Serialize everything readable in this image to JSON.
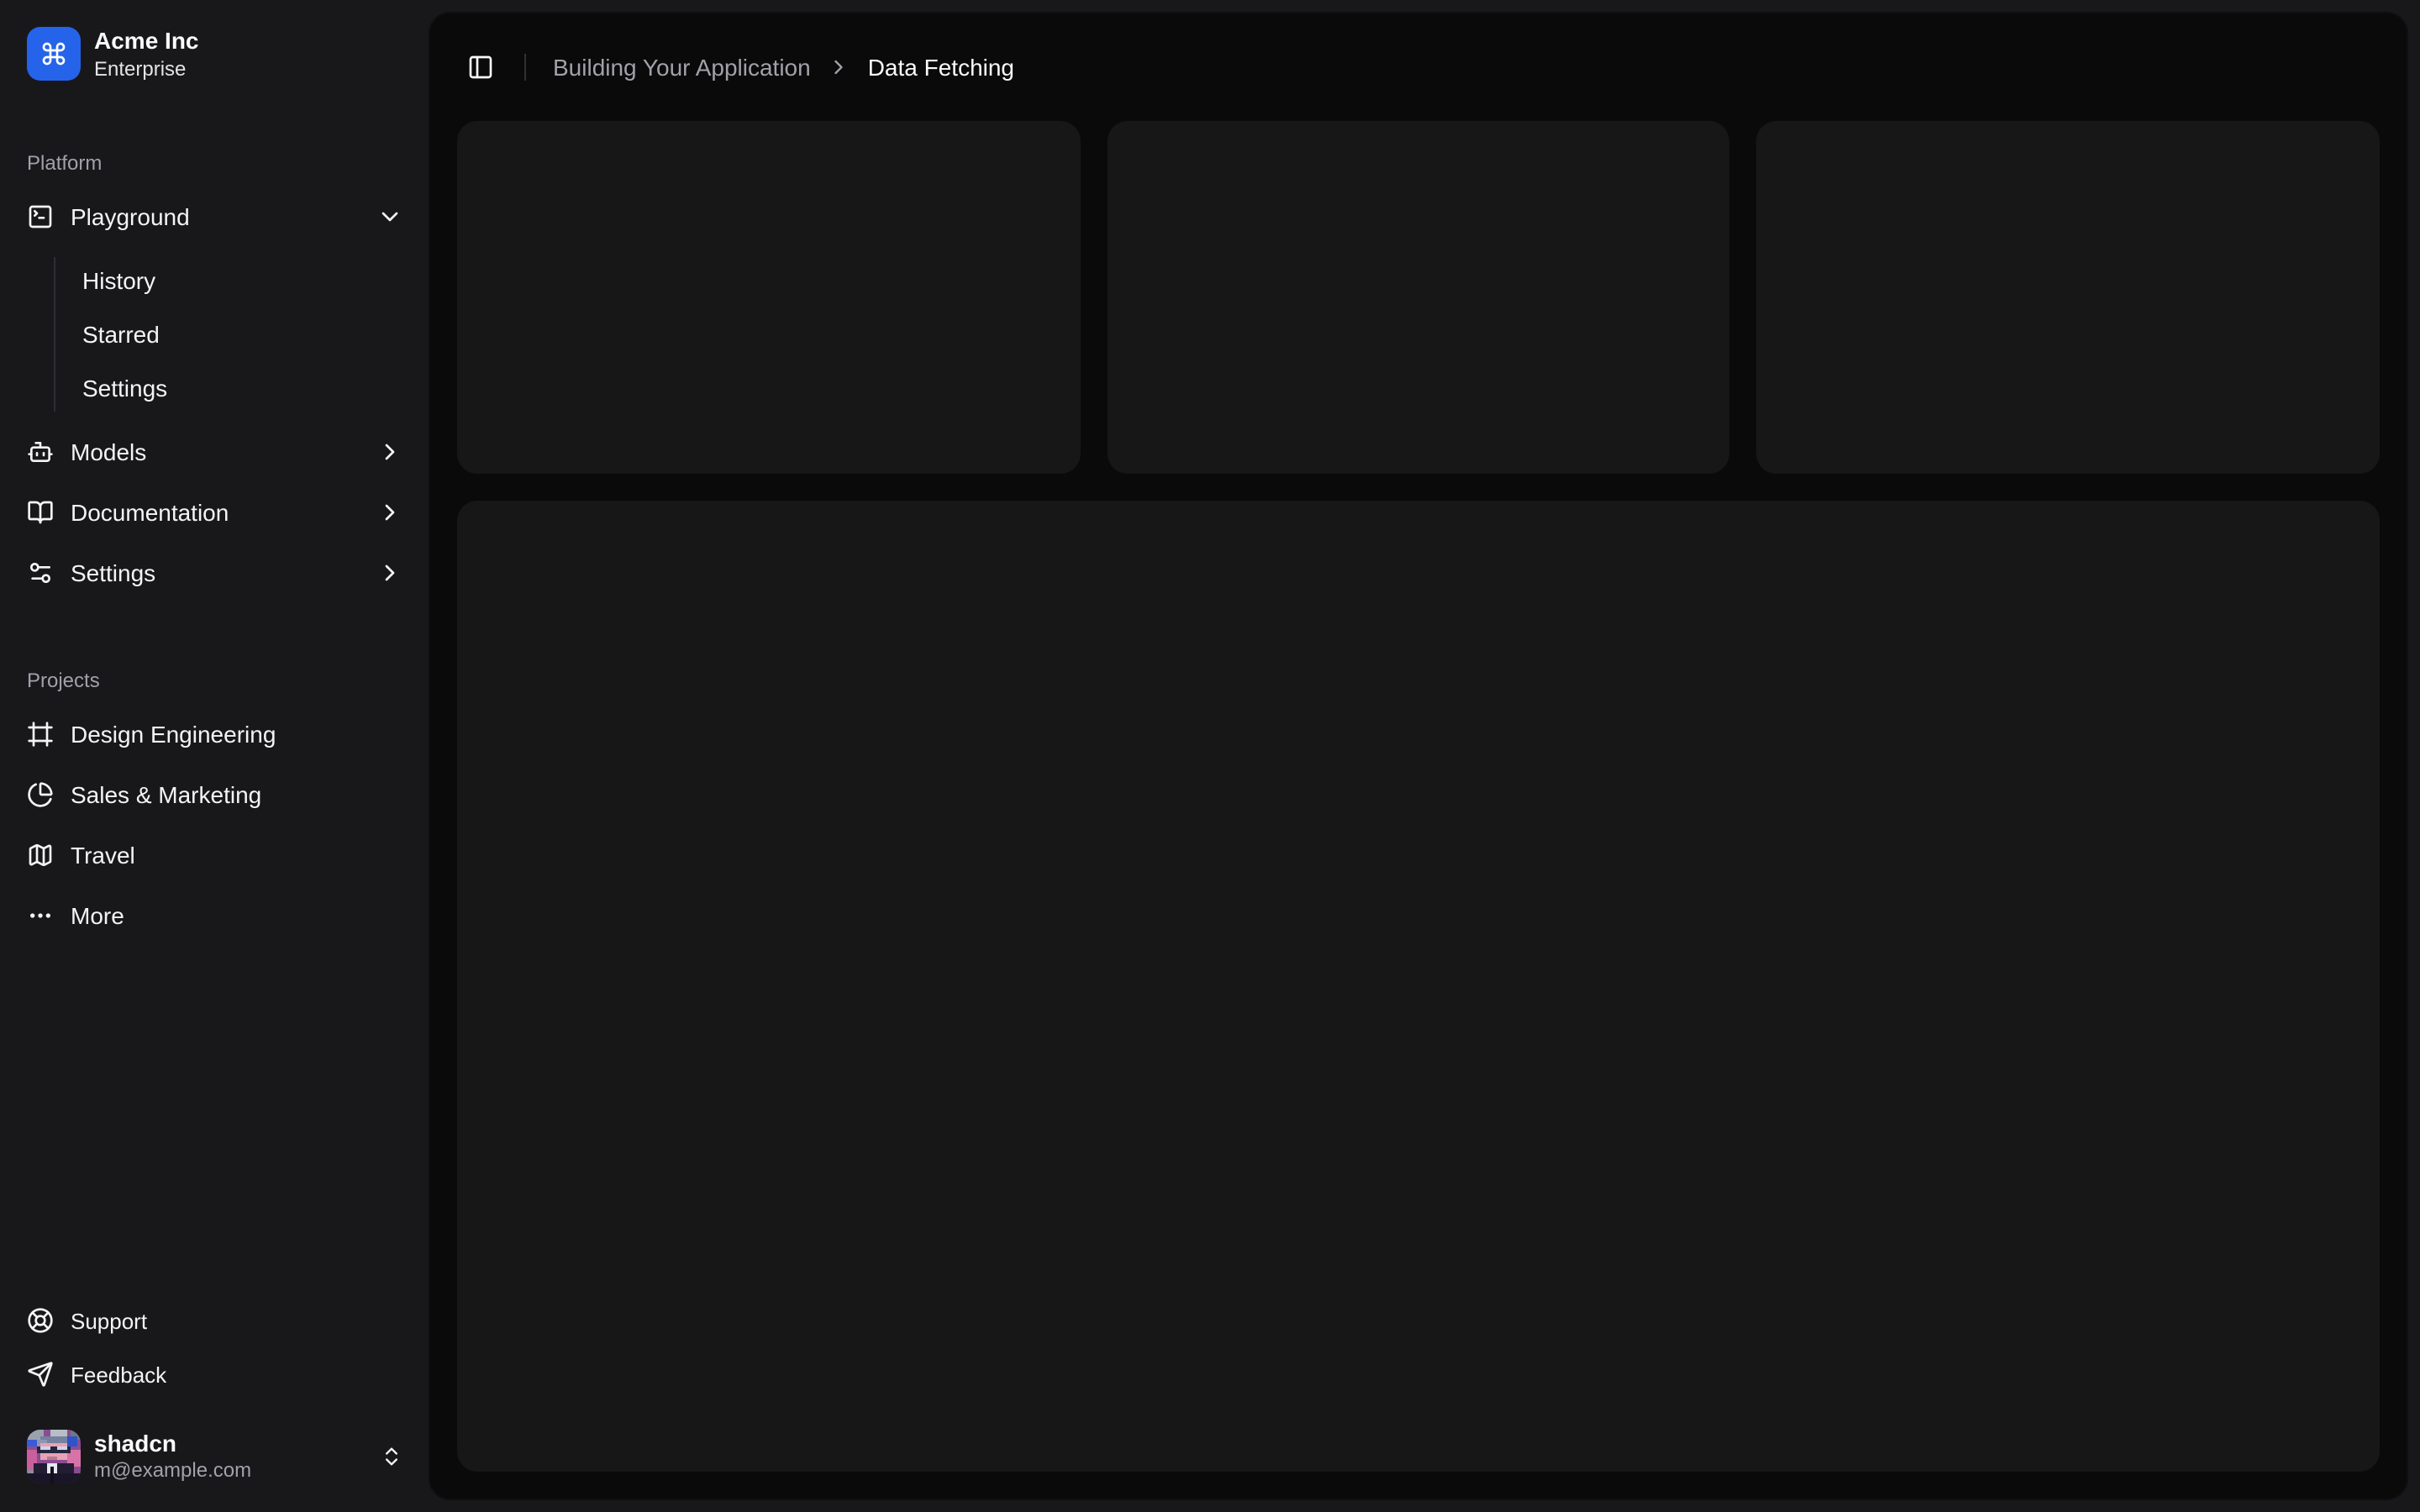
{
  "sidebar": {
    "team": {
      "name": "Acme Inc",
      "plan": "Enterprise",
      "logo_icon": "command-icon",
      "logo_color": "#2563eb"
    },
    "groups": [
      {
        "label": "Platform",
        "items": [
          {
            "label": "Playground",
            "icon": "square-terminal-icon",
            "chevron": "down",
            "expanded": true,
            "children": [
              {
                "label": "History"
              },
              {
                "label": "Starred"
              },
              {
                "label": "Settings"
              }
            ]
          },
          {
            "label": "Models",
            "icon": "bot-icon",
            "chevron": "right"
          },
          {
            "label": "Documentation",
            "icon": "book-open-icon",
            "chevron": "right"
          },
          {
            "label": "Settings",
            "icon": "sliders-icon",
            "chevron": "right"
          }
        ]
      },
      {
        "label": "Projects",
        "items": [
          {
            "label": "Design Engineering",
            "icon": "frame-icon"
          },
          {
            "label": "Sales & Marketing",
            "icon": "pie-chart-icon"
          },
          {
            "label": "Travel",
            "icon": "map-icon"
          },
          {
            "label": "More",
            "icon": "ellipsis-icon"
          }
        ]
      }
    ],
    "secondary": [
      {
        "label": "Support",
        "icon": "life-buoy-icon"
      },
      {
        "label": "Feedback",
        "icon": "send-icon"
      }
    ],
    "user": {
      "name": "shadcn",
      "email": "m@example.com"
    }
  },
  "header": {
    "breadcrumb": {
      "section": "Building Your Application",
      "page": "Data Fetching"
    }
  },
  "main": {
    "placeholder_card_count": 3
  },
  "colors": {
    "sidebar_bg": "#18181b",
    "content_bg": "#0a0a0a",
    "card_bg": "#171717",
    "accent_blue": "#2563eb",
    "text_primary": "#fafafa",
    "text_muted": "#a1a1aa"
  }
}
